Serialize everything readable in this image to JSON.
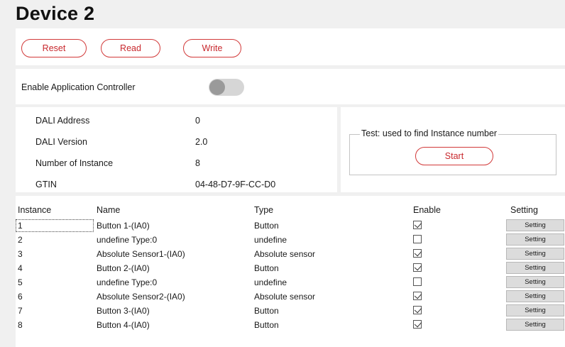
{
  "title": "Device 2",
  "toolbar": {
    "reset_label": "Reset",
    "read_label": "Read",
    "write_label": "Write"
  },
  "enable_app_controller": {
    "label": "Enable Application Controller",
    "value": false
  },
  "info": [
    {
      "label": "DALI Address",
      "value": "0"
    },
    {
      "label": "DALI Version",
      "value": "2.0"
    },
    {
      "label": "Number of Instance",
      "value": "8"
    },
    {
      "label": "GTIN",
      "value": "04-48-D7-9F-CC-D0"
    }
  ],
  "test": {
    "group_title": "Test: used to find Instance number",
    "start_label": "Start"
  },
  "table": {
    "headers": {
      "instance": "Instance",
      "name": "Name",
      "type": "Type",
      "enable": "Enable",
      "setting": "Setting"
    },
    "rows": [
      {
        "instance": "1",
        "name": "Button 1-(IA0)",
        "type": "Button",
        "enabled": true,
        "setting": "Setting"
      },
      {
        "instance": "2",
        "name": "undefine Type:0",
        "type": "undefine",
        "enabled": false,
        "setting": "Setting"
      },
      {
        "instance": "3",
        "name": "Absolute Sensor1-(IA0)",
        "type": "Absolute sensor",
        "enabled": true,
        "setting": "Setting"
      },
      {
        "instance": "4",
        "name": "Button 2-(IA0)",
        "type": "Button",
        "enabled": true,
        "setting": "Setting"
      },
      {
        "instance": "5",
        "name": "undefine Type:0",
        "type": "undefine",
        "enabled": false,
        "setting": "Setting"
      },
      {
        "instance": "6",
        "name": "Absolute Sensor2-(IA0)",
        "type": "Absolute sensor",
        "enabled": true,
        "setting": "Setting"
      },
      {
        "instance": "7",
        "name": "Button 3-(IA0)",
        "type": "Button",
        "enabled": true,
        "setting": "Setting"
      },
      {
        "instance": "8",
        "name": "Button 4-(IA0)",
        "type": "Button",
        "enabled": true,
        "setting": "Setting"
      }
    ]
  }
}
